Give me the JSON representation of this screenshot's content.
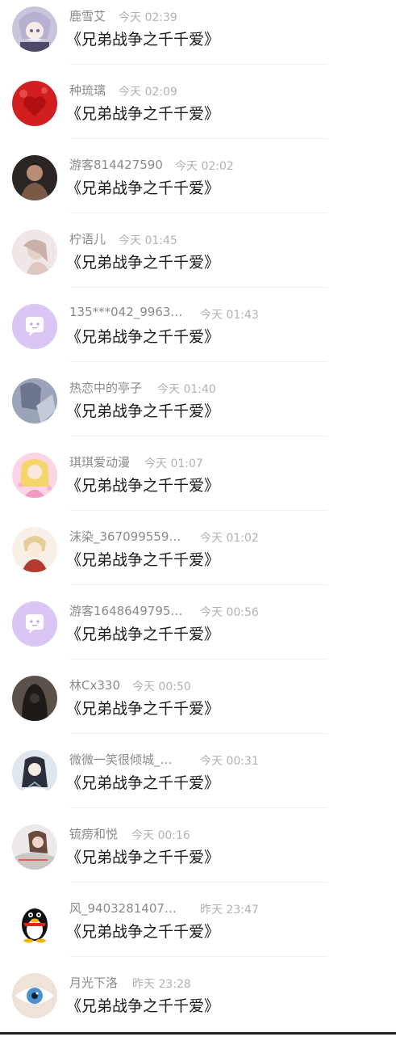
{
  "comments": [
    {
      "name": "鹿雪艾",
      "time": "今天 02:39",
      "text": "《兄弟战争之千千爱》",
      "avatar": "anime-girl-avatar"
    },
    {
      "name": "种琉璃",
      "time": "今天 02:09",
      "text": "《兄弟战争之千千爱》",
      "avatar": "red-heart-avatar"
    },
    {
      "name": "游客814427590",
      "time": "今天 02:02",
      "text": "《兄弟战争之千千爱》",
      "avatar": "man-photo-avatar"
    },
    {
      "name": "柠语儿",
      "time": "今天 01:45",
      "text": "《兄弟战争之千千爱》",
      "avatar": "woman-photo-avatar"
    },
    {
      "name": "135***042_9963…",
      "time": "今天 01:43",
      "text": "《兄弟战争之千千爱》",
      "avatar": "default-chat-avatar"
    },
    {
      "name": "热恋中的亭子",
      "time": "今天 01:40",
      "text": "《兄弟战争之千千爱》",
      "avatar": "anime-art-avatar"
    },
    {
      "name": "琪琪爱动漫",
      "time": "今天 01:07",
      "text": "《兄弟战争之千千爱》",
      "avatar": "anime-princess-avatar"
    },
    {
      "name": "沫染_367099559…",
      "time": "今天 01:02",
      "text": "《兄弟战争之千千爱》",
      "avatar": "anime-boy-avatar"
    },
    {
      "name": "游客1648649795…",
      "time": "今天 00:56",
      "text": "《兄弟战争之千千爱》",
      "avatar": "default-chat-avatar"
    },
    {
      "name": "林Cx330",
      "time": "今天 00:50",
      "text": "《兄弟战争之千千爱》",
      "avatar": "dark-hood-avatar"
    },
    {
      "name": "微微一笑很倾城_…",
      "time": "今天 00:31",
      "text": "《兄弟战争之千千爱》",
      "avatar": "anime-character-avatar"
    },
    {
      "name": "锍痨和悦",
      "time": "今天 00:16",
      "text": "《兄弟战争之千千爱》",
      "avatar": "girl-photo-avatar"
    },
    {
      "name": "风_9403281407…",
      "time": "昨天 23:47",
      "text": "《兄弟战争之千千爱》",
      "avatar": "qq-penguin-avatar"
    },
    {
      "name": "月光下洛",
      "time": "昨天 23:28",
      "text": "《兄弟战争之千千爱》",
      "avatar": "eye-closeup-avatar"
    }
  ],
  "colors": {
    "name": "#8a8a8a",
    "time": "#b2b2b2",
    "message": "#1a1a1a",
    "default_avatar": "#d9c6f5"
  }
}
